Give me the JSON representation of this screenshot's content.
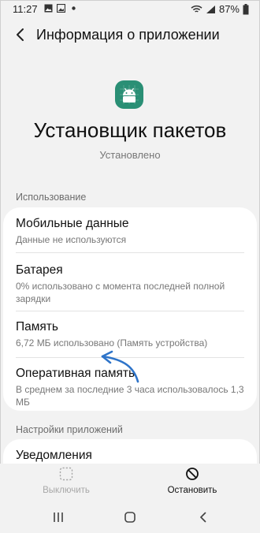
{
  "status_bar": {
    "time": "11:27",
    "battery": "87%"
  },
  "header": {
    "title": "Информация о приложении"
  },
  "app": {
    "name": "Установщик пакетов",
    "status": "Установлено"
  },
  "usage": {
    "section_label": "Использование",
    "items": [
      {
        "title": "Мобильные данные",
        "subtitle": "Данные не используются"
      },
      {
        "title": "Батарея",
        "subtitle": "0% использовано с момента последней полной зарядки"
      },
      {
        "title": "Память",
        "subtitle": "6,72 МБ использовано (Память устройства)"
      },
      {
        "title": "Оперативная память",
        "subtitle": "В среднем за последние 3 часа использовалось 1,3 МБ"
      }
    ]
  },
  "settings": {
    "section_label": "Настройки приложений",
    "items": [
      {
        "title": "Уведомления"
      }
    ]
  },
  "actions": {
    "disable_label": "Выключить",
    "stop_label": "Остановить"
  },
  "colors": {
    "app_icon_bg": "#2a8f75",
    "annotation_arrow": "#2e74c9"
  }
}
